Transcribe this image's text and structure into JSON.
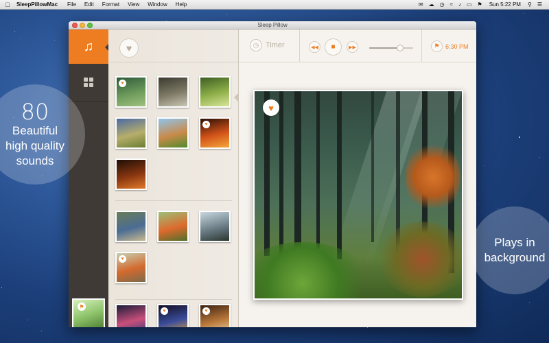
{
  "menubar": {
    "app_name": "SleepPillowMac",
    "menus": [
      "File",
      "Edit",
      "Format",
      "View",
      "Window",
      "Help"
    ],
    "clock": "Sun 5:22 PM"
  },
  "window": {
    "title": "Sleep Pillow"
  },
  "toolbar": {
    "timer_label": "Timer",
    "alarm_time": "6:30 PM",
    "volume_level": 0.7
  },
  "promo": {
    "left_number": "80",
    "left_lines": [
      "Beautiful",
      "high quality",
      "sounds"
    ],
    "right_lines": [
      "Plays in",
      "background"
    ]
  },
  "sounds": [
    {
      "name": "forest",
      "favorite": true,
      "colors": [
        "#2e5a3a",
        "#6d9a5b",
        "#9fc27f"
      ]
    },
    {
      "name": "cave-waterfall",
      "favorite": false,
      "colors": [
        "#3a3a2e",
        "#7e7a66",
        "#c9c6b5"
      ]
    },
    {
      "name": "sunny-forest",
      "favorite": false,
      "colors": [
        "#3e5f22",
        "#8fb04a",
        "#d9e59a"
      ]
    },
    {
      "name": "grass-field",
      "favorite": false,
      "colors": [
        "#4c6aa3",
        "#b6ae6b",
        "#6b7e33"
      ]
    },
    {
      "name": "horse",
      "favorite": false,
      "colors": [
        "#8fc4ec",
        "#c98a4a",
        "#4f8a2d"
      ]
    },
    {
      "name": "campfire",
      "favorite": true,
      "colors": [
        "#2a0f05",
        "#d2531a",
        "#f4a73a"
      ]
    },
    {
      "name": "fireplace",
      "favorite": false,
      "colors": [
        "#1e0e06",
        "#8a3710",
        "#e07b2a"
      ]
    },
    {
      "name": "blue-bird",
      "favorite": false,
      "colors": [
        "#6a7d58",
        "#4b6c94",
        "#c8b98e"
      ]
    },
    {
      "name": "robin",
      "favorite": false,
      "colors": [
        "#9bc07a",
        "#dd6a2d",
        "#4f6e2a"
      ]
    },
    {
      "name": "lapwings",
      "favorite": false,
      "colors": [
        "#c9d7e0",
        "#6b7e86",
        "#2b3530"
      ]
    },
    {
      "name": "robin-on-branch",
      "favorite": true,
      "colors": [
        "#c7d0b2",
        "#d36a2e",
        "#7b6a4a"
      ]
    },
    {
      "name": "city-night",
      "favorite": false,
      "colors": [
        "#1a1c3a",
        "#c94f7a",
        "#2d3c7a"
      ]
    },
    {
      "name": "night-street",
      "favorite": true,
      "colors": [
        "#120d22",
        "#3a4d9a",
        "#e0a040"
      ]
    },
    {
      "name": "cafe",
      "favorite": true,
      "colors": [
        "#3a2212",
        "#b9773a",
        "#f0d8a8"
      ]
    }
  ],
  "now_playing": {
    "name": "forest",
    "favorite": true
  },
  "icons": {
    "music": "music-note-icon",
    "grid": "grid-icon",
    "heart": "heart-icon",
    "timer": "timer-icon",
    "rewind": "rewind-icon",
    "stop": "stop-icon",
    "forward": "fast-forward-icon",
    "alarm": "alarm-bell-icon"
  },
  "colors": {
    "accent": "#ee7d22",
    "nav_bg": "#3f3a36"
  }
}
